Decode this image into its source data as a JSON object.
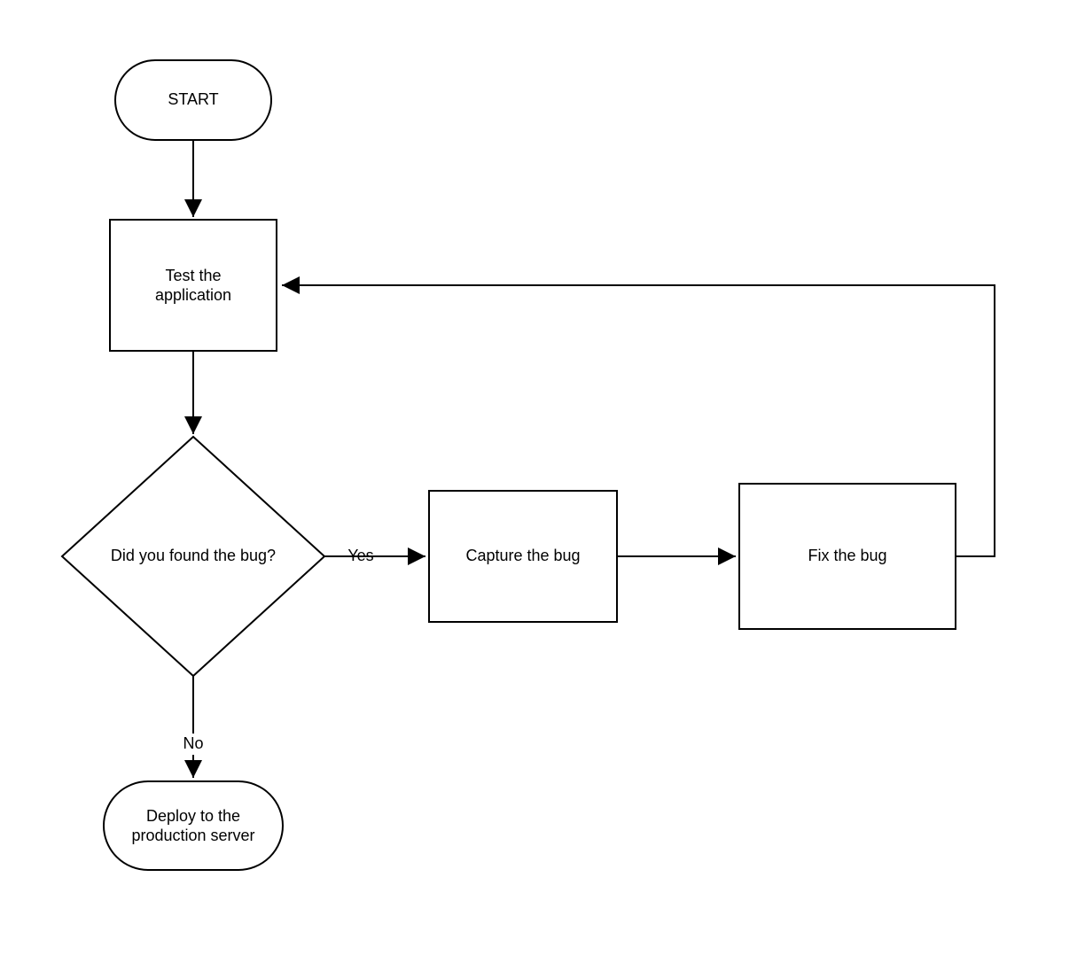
{
  "diagram": {
    "type": "flowchart",
    "nodes": {
      "start": {
        "shape": "terminator",
        "label": "START"
      },
      "test": {
        "shape": "process",
        "label_line1": "Test the",
        "label_line2": "application"
      },
      "decision": {
        "shape": "decision",
        "label": "Did you found the bug?"
      },
      "capture": {
        "shape": "process",
        "label": "Capture the bug"
      },
      "fix": {
        "shape": "process",
        "label": "Fix the bug"
      },
      "deploy": {
        "shape": "terminator",
        "label_line1": "Deploy to the",
        "label_line2": "production server"
      }
    },
    "edges": {
      "yes": {
        "label": "Yes"
      },
      "no": {
        "label": "No"
      }
    }
  }
}
